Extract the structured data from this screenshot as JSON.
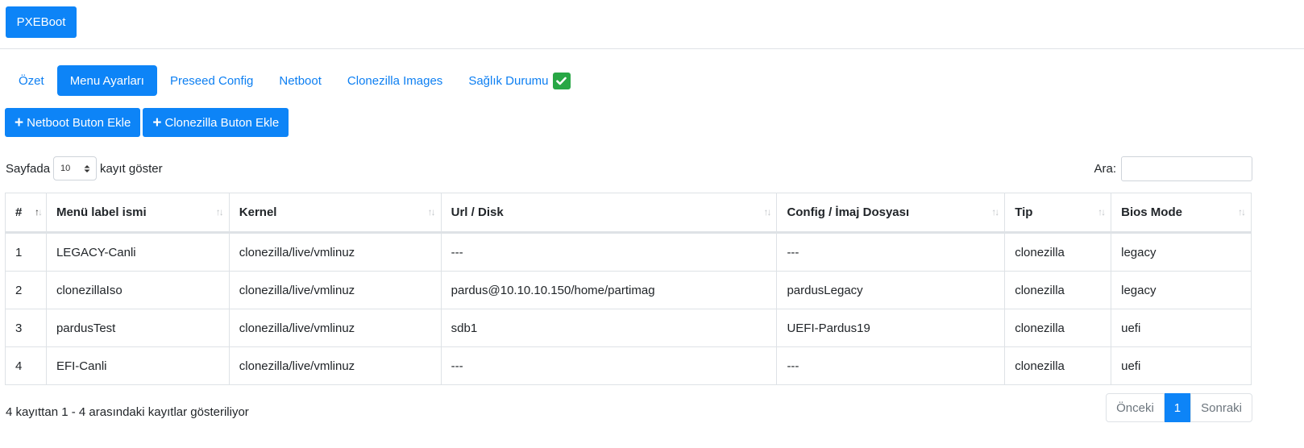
{
  "header": {
    "brand": "PXEBoot"
  },
  "tabs": [
    {
      "label": "Özet"
    },
    {
      "label": "Menu Ayarları"
    },
    {
      "label": "Preseed Config"
    },
    {
      "label": "Netboot"
    },
    {
      "label": "Clonezilla Images"
    },
    {
      "label": "Sağlık Durumu"
    }
  ],
  "actions": {
    "netboot": "Netboot Buton Ekle",
    "clonezilla": "Clonezilla Buton Ekle"
  },
  "length": {
    "prefix": "Sayfada",
    "value": "10",
    "suffix": "kayıt göster"
  },
  "search": {
    "label": "Ara:",
    "value": ""
  },
  "table": {
    "columns": [
      "#",
      "Menü label ismi",
      "Kernel",
      "Url / Disk",
      "Config / İmaj Dosyası",
      "Tip",
      "Bios Mode"
    ],
    "rows": [
      [
        "1",
        "LEGACY-Canli",
        "clonezilla/live/vmlinuz",
        "---",
        "---",
        "clonezilla",
        "legacy"
      ],
      [
        "2",
        "clonezillaIso",
        "clonezilla/live/vmlinuz",
        "pardus@10.10.10.150/home/partimag",
        "pardusLegacy",
        "clonezilla",
        "legacy"
      ],
      [
        "3",
        "pardusTest",
        "clonezilla/live/vmlinuz",
        "sdb1",
        "UEFI-Pardus19",
        "clonezilla",
        "uefi"
      ],
      [
        "4",
        "EFI-Canli",
        "clonezilla/live/vmlinuz",
        "---",
        "---",
        "clonezilla",
        "uefi"
      ]
    ]
  },
  "footer": {
    "info": "4 kayıttan 1 - 4 arasındaki kayıtlar gösteriliyor"
  },
  "pagination": {
    "prev": "Önceki",
    "current": "1",
    "next": "Sonraki"
  },
  "colors": {
    "primary": "#0d84f7",
    "success": "#28a745",
    "link": "#0d7ff2"
  }
}
